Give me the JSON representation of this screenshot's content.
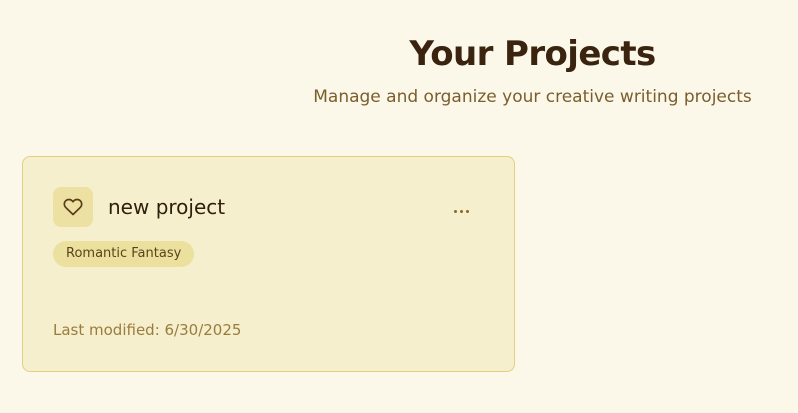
{
  "header": {
    "title": "Your Projects",
    "subtitle": "Manage and organize your creative writing projects"
  },
  "projects": [
    {
      "name": "new project",
      "icon": "heart-icon",
      "genre": "Romantic Fantasy",
      "last_modified": "Last modified: 6/30/2025",
      "menu_icon": "more-horizontal-icon"
    }
  ],
  "colors": {
    "background": "#fbf8e9",
    "card_background": "#f5efcd",
    "card_border": "#e2cf82",
    "title_text": "#3a2410",
    "accent_text": "#7a5e2c",
    "badge_background": "#ebe09e"
  }
}
